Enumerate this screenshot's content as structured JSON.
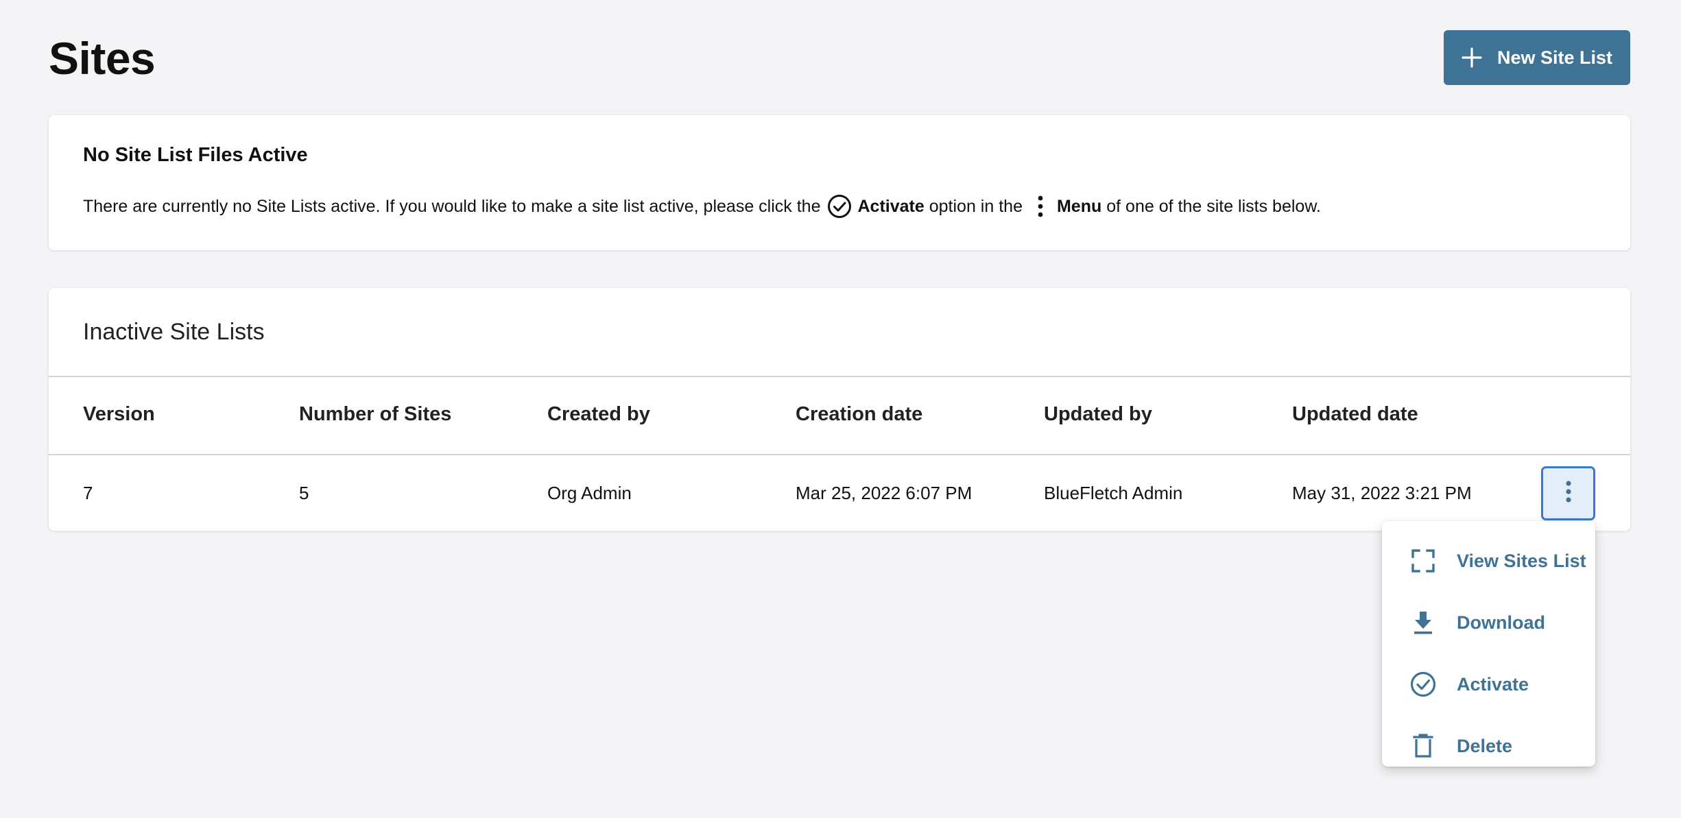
{
  "header": {
    "title": "Sites",
    "new_button_label": "New Site List"
  },
  "notice": {
    "title": "No Site List Files Active",
    "text_before": "There are currently no Site Lists active. If you would like to make a site list active, please click the",
    "activate_word": "Activate",
    "text_middle": "option in the",
    "menu_word": "Menu",
    "text_after": "of one of the site lists below."
  },
  "inactive": {
    "title": "Inactive Site Lists",
    "columns": [
      "Version",
      "Number of Sites",
      "Created by",
      "Creation date",
      "Updated by",
      "Updated date"
    ],
    "rows": [
      [
        "7",
        "5",
        "Org Admin",
        "Mar 25, 2022 6:07 PM",
        "BlueFletch Admin",
        "May 31, 2022 3:21 PM"
      ]
    ]
  },
  "row_menu": {
    "items": [
      {
        "label": "View Sites List",
        "icon": "fullscreen-icon"
      },
      {
        "label": "Download",
        "icon": "download-icon"
      },
      {
        "label": "Activate",
        "icon": "check-circle-icon"
      },
      {
        "label": "Delete",
        "icon": "trash-icon"
      }
    ]
  },
  "colors": {
    "primary": "#3f7396",
    "background": "#f4f4f6",
    "focus_border": "#3a78c9"
  }
}
